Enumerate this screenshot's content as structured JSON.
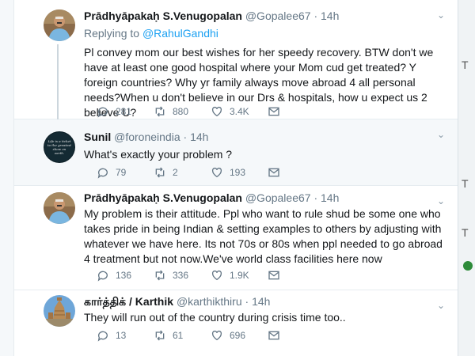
{
  "tweets": [
    {
      "name": "Prādhyāpakaḥ S.Venugopalan",
      "handle": "@Gopalee67",
      "time": "14h",
      "replying_label": "Replying to",
      "replying_to": "@RahulGandhi",
      "text": "Pl convey mom our best wishes for her speedy recovery. BTW don't we have at least one good hospital where your Mom cud get treated? Y foreign countries? Why yr family always move abroad 4 all personal needs?When u don't believe in our Drs & hospitals, how u expect us 2 believe U?",
      "replies": "281",
      "retweets": "880",
      "likes": "3.4K"
    },
    {
      "name": "Sunil",
      "handle": "@foroneindia",
      "time": "14h",
      "text": "What's exactly your problem ?",
      "avatar_text": "Life is a ticket to the greatest show on earth.",
      "replies": "79",
      "retweets": "2",
      "likes": "193"
    },
    {
      "name": "Prādhyāpakaḥ S.Venugopalan",
      "handle": "@Gopalee67",
      "time": "14h",
      "text": "My problem is their attitude. Ppl who want to rule shud be some one who takes pride in being Indian & setting examples to others by adjusting with whatever we have here. Its not 70s or 80s when ppl needed to go abroad 4 treatment but not now.We've world class facilities here now",
      "replies": "136",
      "retweets": "336",
      "likes": "1.9K"
    },
    {
      "name": "கார்த்திக் / Karthik",
      "handle": "@karthikthiru",
      "time": "14h",
      "text": "They will run out of the country during crisis time too..",
      "replies": "13",
      "retweets": "61",
      "likes": "696"
    }
  ],
  "separator": "·",
  "right_edge_fragments": [
    "T",
    "T",
    "T"
  ],
  "colors": {
    "text": "#14171a",
    "secondary": "#657786",
    "link": "#1da1f2",
    "highlight_bg": "#f5f8fa",
    "thread_line": "#ccd6dd"
  }
}
